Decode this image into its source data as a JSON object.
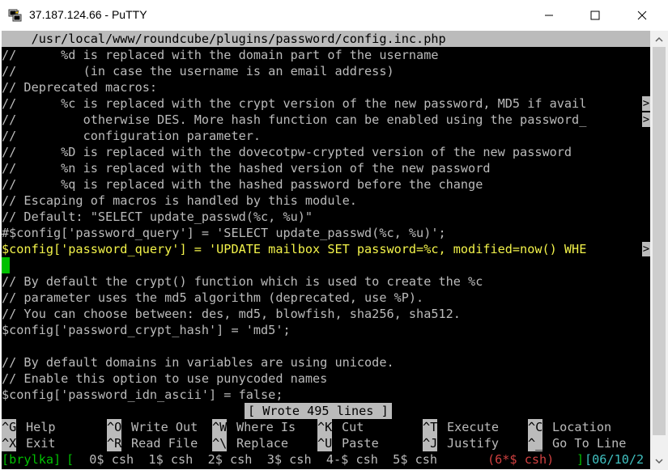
{
  "window": {
    "title": "37.187.124.66 - PuTTY"
  },
  "editor": {
    "header": "    /usr/local/www/roundcube/plugins/password/config.inc.php",
    "lines": [
      "//      %d is replaced with the domain part of the username",
      "//         (in case the username is an email address)",
      "// Deprecated macros:",
      "//      %c is replaced with the crypt version of the new password, MD5 if avail",
      "//         otherwise DES. More hash function can be enabled using the password_",
      "//         configuration parameter.",
      "//      %D is replaced with the dovecotpw-crypted version of the new password",
      "//      %n is replaced with the hashed version of the new password",
      "//      %q is replaced with the hashed password before the change",
      "// Escaping of macros is handled by this module.",
      "// Default: \"SELECT update_passwd(%c, %u)\"",
      "#$config['password_query'] = 'SELECT update_passwd(%c, %u)';",
      "$config['password_query'] = 'UPDATE mailbox SET password=%c, modified=now() WHE",
      "",
      "// By default the crypt() function which is used to create the %c",
      "// parameter uses the md5 algorithm (deprecated, use %P).",
      "// You can choose between: des, md5, blowfish, sha256, sha512.",
      "$config['password_crypt_hash'] = 'md5';",
      "",
      "// By default domains in variables are using unicode.",
      "// Enable this option to use punycoded names",
      "$config['password_idn_ascii'] = false;"
    ],
    "more_marker": ">",
    "status": "[ Wrote 495 lines ]"
  },
  "shortcuts": [
    {
      "key": "^G",
      "label": "Help"
    },
    {
      "key": "^O",
      "label": "Write Out"
    },
    {
      "key": "^W",
      "label": "Where Is"
    },
    {
      "key": "^K",
      "label": "Cut"
    },
    {
      "key": "^T",
      "label": "Execute"
    },
    {
      "key": "^C",
      "label": "Location"
    },
    {
      "key": "^X",
      "label": "Exit"
    },
    {
      "key": "^R",
      "label": "Read File"
    },
    {
      "key": "^\\",
      "label": "Replace"
    },
    {
      "key": "^U",
      "label": "Paste"
    },
    {
      "key": "^J",
      "label": "Justify"
    },
    {
      "key": "^_",
      "label": "Go To Line"
    }
  ],
  "tmux": {
    "session": "[brylka]",
    "open": "[",
    "windows": "  0$ csh  1$ csh  2$ csh  3$ csh  4-$ csh  5$ csh  ",
    "active": "(6*$ csh)",
    "gap": "  ",
    "close": "]",
    "date": "[06/10/2"
  },
  "colors": {
    "terminal_bg": "#000000",
    "text": "#bbbbbb",
    "highlight": "#f3f34a",
    "cursor": "#00c000",
    "tmux_green": "#00c000",
    "tmux_red": "#d04040"
  }
}
